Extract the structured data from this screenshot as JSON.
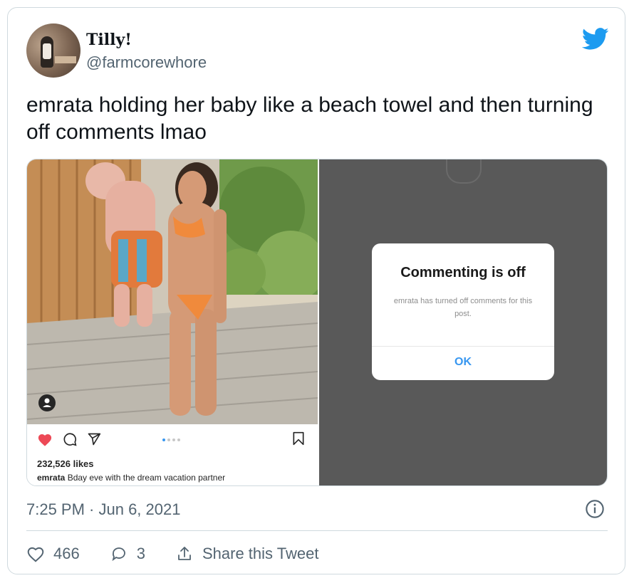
{
  "user": {
    "display_name": "Tilly!",
    "handle": "@farmcorewhore",
    "avatar_icon": "avatar"
  },
  "brand_icon": "twitter-bird-icon",
  "colors": {
    "twitter_blue": "#1d9bf0",
    "ig_blue": "#3897f0",
    "like_red": "#ed4956"
  },
  "tweet": {
    "text": "emrata holding her baby like a beach towel and then turning off comments lmao",
    "timestamp": "7:25 PM · Jun 6, 2021"
  },
  "instagram_post": {
    "likes": "232,526 likes",
    "caption_user": "emrata",
    "caption_text": " Bday eve with the dream vacation partner",
    "carousel_dots": 4,
    "active_dot": 1
  },
  "dialog": {
    "title": "Commenting is off",
    "body": "emrata has turned off comments for this post.",
    "ok_label": "OK"
  },
  "actions": {
    "like_count": "466",
    "reply_count": "3",
    "share_label": "Share this Tweet"
  }
}
